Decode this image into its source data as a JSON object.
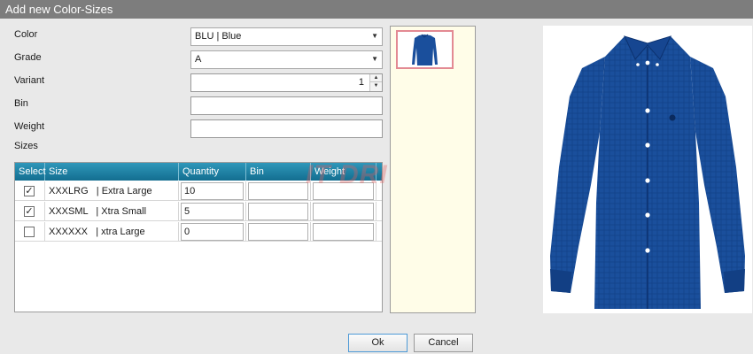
{
  "dialog": {
    "title": "Add new Color-Sizes"
  },
  "form": {
    "color_label": "Color",
    "color_value": "BLU | Blue",
    "grade_label": "Grade",
    "grade_value": "A",
    "variant_label": "Variant",
    "variant_value": "1",
    "bin_label": "Bin",
    "bin_value": "",
    "weight_label": "Weight",
    "weight_value": "",
    "sizes_label": "Sizes"
  },
  "grid": {
    "columns": [
      "Select",
      "Size",
      "Quantity",
      "Bin",
      "Weight"
    ],
    "rows": [
      {
        "selected": true,
        "size": "XXXLRG   | Extra Large",
        "quantity": "10",
        "bin": "",
        "weight": ""
      },
      {
        "selected": true,
        "size": "XXXSML   | Xtra Small",
        "quantity": "5",
        "bin": "",
        "weight": ""
      },
      {
        "selected": false,
        "size": "XXXXXX   | xtra Large",
        "quantity": "0",
        "bin": "",
        "weight": ""
      }
    ]
  },
  "watermark": "IT DRIVE",
  "buttons": {
    "ok": "Ok",
    "cancel": "Cancel"
  },
  "icons": {
    "dropdown": "chevron-down-icon",
    "spin_up": "spin-up-icon",
    "spin_down": "spin-down-icon",
    "check": "check-icon"
  },
  "colors": {
    "header": "#1d7ea3",
    "title_bar": "#7d7d7d",
    "thumb_panel": "#fffde8",
    "shirt": "#1a4f9c",
    "thumb_border": "#e38a93"
  }
}
